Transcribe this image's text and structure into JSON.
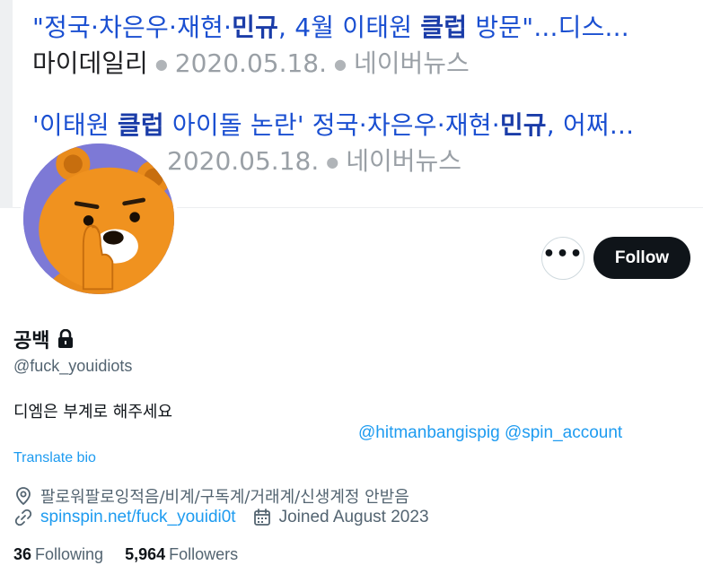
{
  "banner": {
    "results": [
      {
        "title_parts": [
          {
            "text": "\"정국·차은우·재현·",
            "bold": false
          },
          {
            "text": "민규",
            "bold": true
          },
          {
            "text": ", 4월 이태원 ",
            "bold": false
          },
          {
            "text": "클럽",
            "bold": true
          },
          {
            "text": " 방문\"...디스...",
            "bold": false
          }
        ],
        "source": "마이데일리",
        "date": "2020.05.18.",
        "portal": "네이버뉴스"
      },
      {
        "title_parts": [
          {
            "text": "'이태원 ",
            "bold": false
          },
          {
            "text": "클럽",
            "bold": true
          },
          {
            "text": " 아이돌 논란' 정국·차은우·재현·",
            "bold": false
          },
          {
            "text": "민규",
            "bold": true
          },
          {
            "text": ", 어쩌...",
            "bold": false
          }
        ],
        "source": "",
        "date": "2020.05.18.",
        "portal": "네이버뉴스"
      }
    ]
  },
  "profile": {
    "display_name": "공백",
    "handle": "@fuck_youidiots",
    "bio": "디엠은 부계로 해주세요",
    "bio_mentions": [
      "@hitmanbangispig",
      "@spin_account"
    ],
    "translate_label": "Translate bio",
    "location": "팔로워팔로잉적음/비계/구독계/거래계/신생계정 안받음",
    "website": "spinspin.net/fuck_youidi0t",
    "joined": "Joined August 2023",
    "following_count": "36",
    "following_label": "Following",
    "followers_count": "5,964",
    "followers_label": "Followers"
  },
  "actions": {
    "more_label": "•••",
    "follow_label": "Follow"
  },
  "icons": {
    "lock": "lock-icon",
    "location": "location-pin-icon",
    "link": "link-icon",
    "calendar": "calendar-icon"
  },
  "colors": {
    "accent": "#1d9bf0",
    "follow_bg": "#0f1419",
    "secondary_text": "#536471",
    "avatar_bg": "#7d79d6",
    "banner_link": "#1a4fd1"
  }
}
